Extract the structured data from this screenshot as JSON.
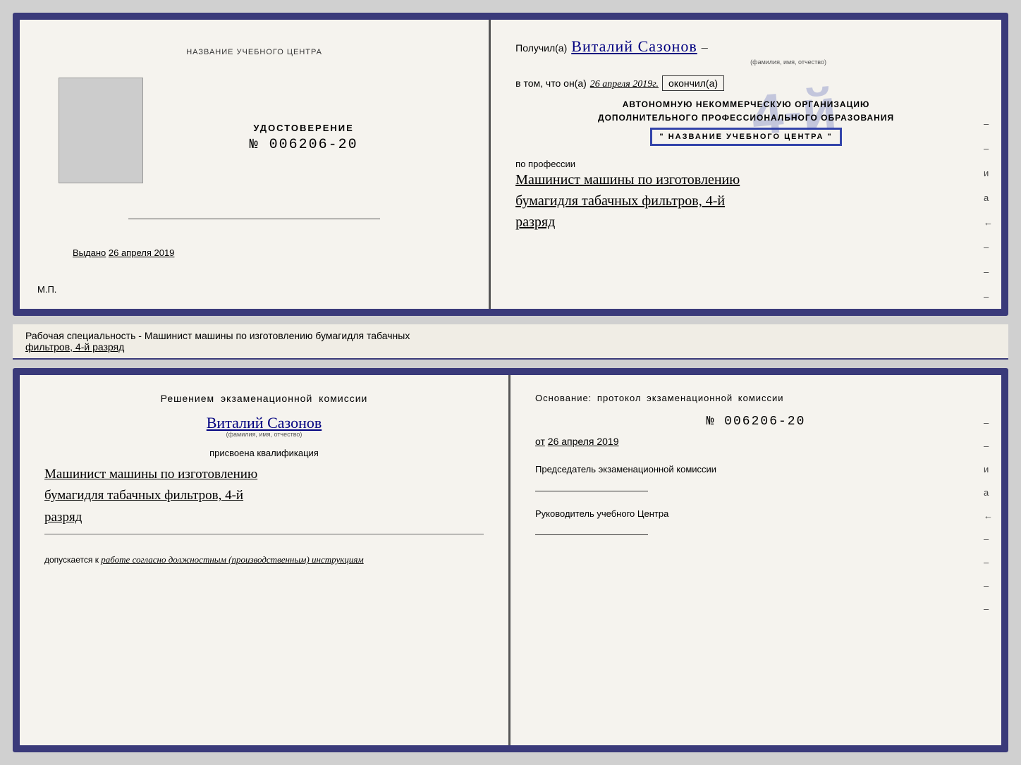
{
  "top_cert": {
    "left": {
      "title": "НАЗВАНИЕ УЧЕБНОГО ЦЕНТРА",
      "label": "УДОСТОВЕРЕНИЕ",
      "number": "№ 006206-20",
      "issued_prefix": "Выдано",
      "issued_date": "26 апреля 2019",
      "mp": "М.П."
    },
    "right": {
      "recipient_prefix": "Получил(а)",
      "recipient_name": "Виталий Сазонов",
      "recipient_dash": "–",
      "name_subtitle": "(фамилия, имя, отчество)",
      "vtom_prefix": "в том, что он(а)",
      "vtom_date": "26 апреля 2019г.",
      "okonchil": "окончил(а)",
      "big_number": "4-й",
      "org_line1": "АВТОНОМНУЮ НЕКОММЕРЧЕСКУЮ ОРГАНИЗАЦИЮ",
      "org_line2": "ДОПОЛНИТЕЛЬНОГО ПРОФЕССИОНАЛЬНОГО ОБРАЗОВАНИЯ",
      "org_name": "\" НАЗВАНИЕ УЧЕБНОГО ЦЕНТРА \"",
      "profession_prefix": "по профессии",
      "profession_line1": "Машинист машины по изготовлению",
      "profession_line2": "бумагидля табачных фильтров, 4-й",
      "profession_line3": "разряд"
    }
  },
  "separator": {
    "text_normal": "Рабочая специальность - Машинист машины по изготовлению бумагидля табачных",
    "text_underline": "фильтров, 4-й разряд"
  },
  "bottom_cert": {
    "left": {
      "commission_title": "Решением  экзаменационной  комиссии",
      "person_name": "Виталий Сазонов",
      "fio_subtitle": "(фамилия, имя, отчество)",
      "qualification_label": "присвоена квалификация",
      "qualification_line1": "Машинист машины по изготовлению",
      "qualification_line2": "бумагидля табачных фильтров, 4-й",
      "qualification_line3": "разряд",
      "dopusk_prefix": "допускается к",
      "dopusk_value": "работе согласно должностным (производственным) инструкциям"
    },
    "right": {
      "osnov_title": "Основание: протокол экзаменационной  комиссии",
      "osnov_number": "№  006206-20",
      "osnov_date_prefix": "от",
      "osnov_date": "26 апреля 2019",
      "chairman_label": "Председатель экзаменационной комиссии",
      "director_label": "Руководитель учебного Центра"
    }
  },
  "right_side_marks": {
    "и": "и",
    "a": "а",
    "arrow": "←"
  }
}
